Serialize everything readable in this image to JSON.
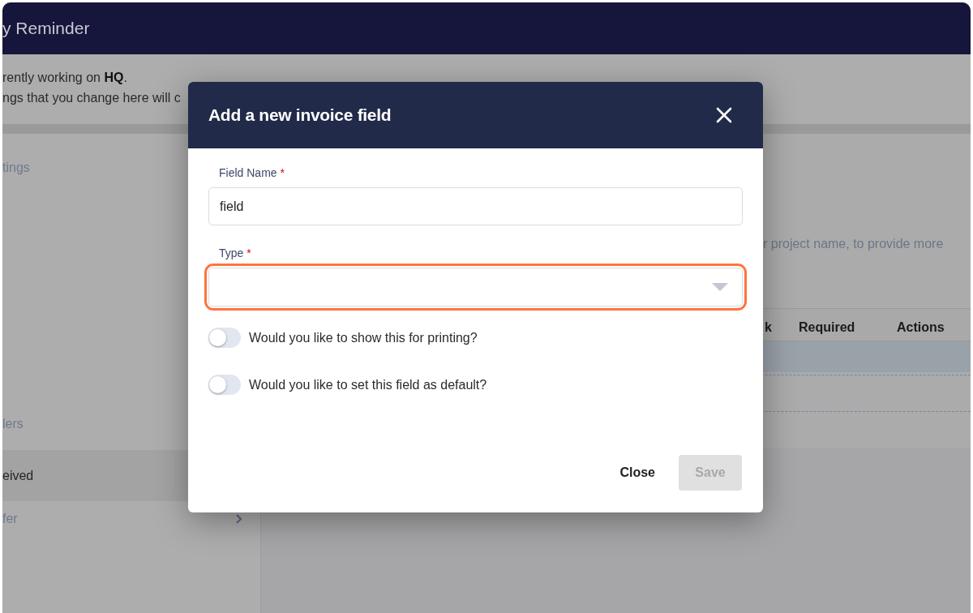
{
  "app_header": {
    "title": "y Reminder"
  },
  "notice": {
    "lines": [
      "rently working on **HQ**.",
      "ngs that you change here will c"
    ]
  },
  "sidebar": {
    "items": [
      {
        "label": "tings",
        "selected": false
      },
      {
        "label": "lers",
        "selected": false
      },
      {
        "label": "eived",
        "selected": true
      },
      {
        "label": "fer",
        "selected": false,
        "chevron": true
      }
    ]
  },
  "panel": {
    "description": "r project name, to provide more",
    "table": {
      "columns": [
        "k",
        "Required",
        "Actions"
      ]
    }
  },
  "dialog": {
    "title": "Add a new invoice field",
    "fields": [
      {
        "kind": "text",
        "label": "Field Name",
        "required_mark": "*",
        "value": "field",
        "highlighted": false
      },
      {
        "kind": "select",
        "label": "Type",
        "required_mark": "*",
        "highlighted": true
      }
    ],
    "toggles": [
      {
        "label": "Would you like to show this for printing?",
        "on": false
      },
      {
        "label": "Would you like to set this field as default?",
        "on": false
      }
    ],
    "buttons": [
      {
        "label": "Close",
        "kind": "text",
        "disabled": false
      },
      {
        "label": "Save",
        "kind": "primary",
        "disabled": true
      }
    ]
  }
}
